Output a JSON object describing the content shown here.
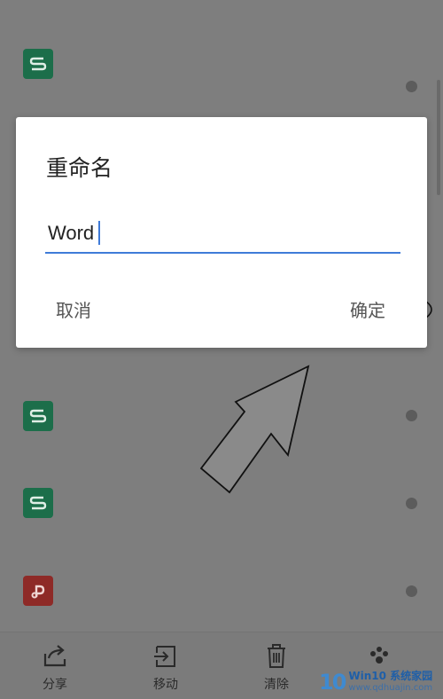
{
  "dialog": {
    "title": "重命名",
    "input_value": "Word",
    "cancel_label": "取消",
    "confirm_label": "确定"
  },
  "files": [
    {
      "type": "sheet",
      "icon": "spreadsheet-icon"
    },
    {
      "type": "sheet",
      "icon": "spreadsheet-icon"
    },
    {
      "type": "sheet",
      "icon": "spreadsheet-icon"
    },
    {
      "type": "presentation",
      "icon": "presentation-icon"
    }
  ],
  "toolbar": {
    "share_label": "分享",
    "move_label": "移动",
    "clear_label": "清除"
  },
  "watermark": {
    "logo": "10",
    "name": "Win10 系统家园",
    "url": "www.qdhuajin.com"
  },
  "colors": {
    "accent": "#3f7bd8",
    "sheet_icon": "#1c6e4a",
    "presentation_icon": "#8e2a27"
  }
}
